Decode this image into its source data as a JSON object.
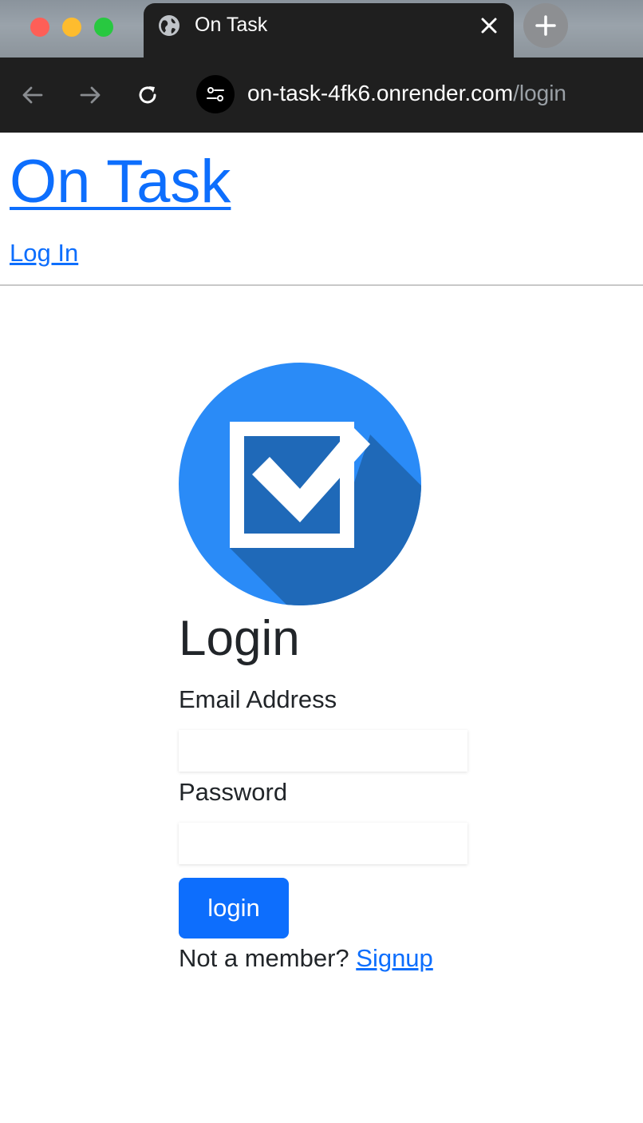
{
  "browser": {
    "tab_title": "On Task",
    "url_host": "on-task-4fk6.onrender.com",
    "url_path": "/login"
  },
  "navbar": {
    "brand": "On Task",
    "login_link": "Log In"
  },
  "login_form": {
    "heading": "Login",
    "email_label": "Email Address",
    "email_value": "",
    "password_label": "Password",
    "password_value": "",
    "submit_label": "login",
    "signup_prompt": "Not a member?",
    "signup_link": "Signup"
  },
  "colors": {
    "link": "#0d6efd",
    "button": "#0d6efd",
    "logo_circle": "#2a8bf7",
    "logo_shadow": "#1f69b8"
  },
  "icons": {
    "tab": "globe-icon",
    "close": "close-icon",
    "new_tab": "plus-icon",
    "back": "arrow-left-icon",
    "forward": "arrow-right-icon",
    "reload": "reload-icon",
    "site_info": "site-settings-icon",
    "logo": "checkbox-logo-icon"
  }
}
